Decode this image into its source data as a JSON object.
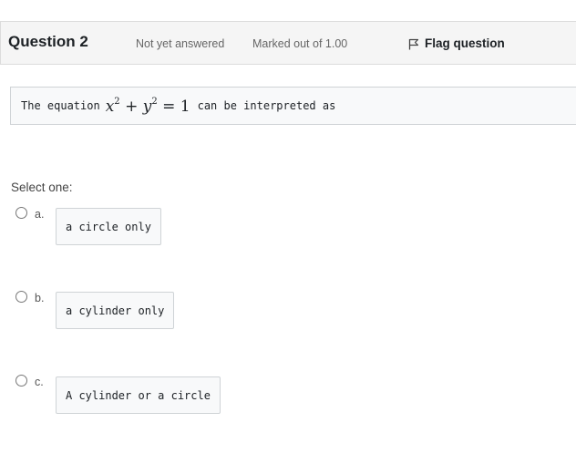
{
  "question": {
    "title": "Question 2",
    "status": "Not yet answered",
    "marked_out_of": "Marked out of 1.00",
    "flag_label": "Flag question",
    "flag_icon": "flag-icon"
  },
  "question_text": {
    "before": "The equation",
    "math": {
      "var1": "x",
      "exp1": "2",
      "plus": "+",
      "var2": "y",
      "exp2": "2",
      "eq": "=",
      "rhs": "1"
    },
    "after": "can be interpreted as"
  },
  "answer": {
    "prompt": "Select one:",
    "options": [
      {
        "letter": "a.",
        "text": "a circle only"
      },
      {
        "letter": "b.",
        "text": "a cylinder only"
      },
      {
        "letter": "c.",
        "text": "A cylinder or a circle"
      }
    ]
  }
}
